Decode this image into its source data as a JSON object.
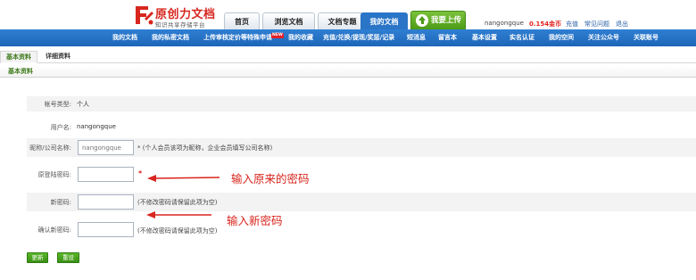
{
  "header": {
    "logo_title": "原创力文档",
    "logo_subtitle": "知识共享存储平台",
    "tabs": [
      {
        "label": "首页"
      },
      {
        "label": "浏览文档"
      },
      {
        "label": "文档专题"
      },
      {
        "label": "我的文档"
      }
    ],
    "upload_label": "我要上传",
    "username": "nangongque",
    "coins": "0.154金币",
    "links": [
      "充值",
      "常见问题",
      "退出"
    ]
  },
  "nav": {
    "items": [
      "我的文档",
      "我的私密文档",
      "上传审核定价等特殊申请",
      "我的收藏",
      "充值/兑换/提现/奖惩/记录",
      "短消息",
      "留言本",
      "基本设置",
      "实名认证",
      "我的空间",
      "关注公众号",
      "关联账号"
    ],
    "new_badge": "NEW"
  },
  "subtabs": [
    "基本资料",
    "详细资料"
  ],
  "section_title": "基本资料",
  "form": {
    "account_type_label": "帐号类型:",
    "account_type_value": "个人",
    "username_label": "用户名:",
    "username_value": "nangongque",
    "nickname_label": "昵称/公司名称:",
    "nickname_value": "nangongque",
    "nickname_hint": "* (个人会员该项为昵称，企业会员填写公司名称)",
    "old_password_label": "原登陆密码:",
    "old_password_required": "*",
    "new_password_label": "新密码:",
    "new_password_hint": "(不修改密码请保留此项为空)",
    "confirm_password_label": "确认新密码:",
    "confirm_password_hint": "(不修改密码请保留此项为空)"
  },
  "annotations": {
    "old_password_note": "输入原来的密码",
    "new_password_note": "输入新密码"
  },
  "buttons": {
    "submit": "更新",
    "reset": "重设"
  },
  "colors": {
    "nav_blue": "#1d66b8",
    "accent_red": "#d8251d",
    "button_green": "#3a8f14",
    "coin_red": "#e02020"
  }
}
